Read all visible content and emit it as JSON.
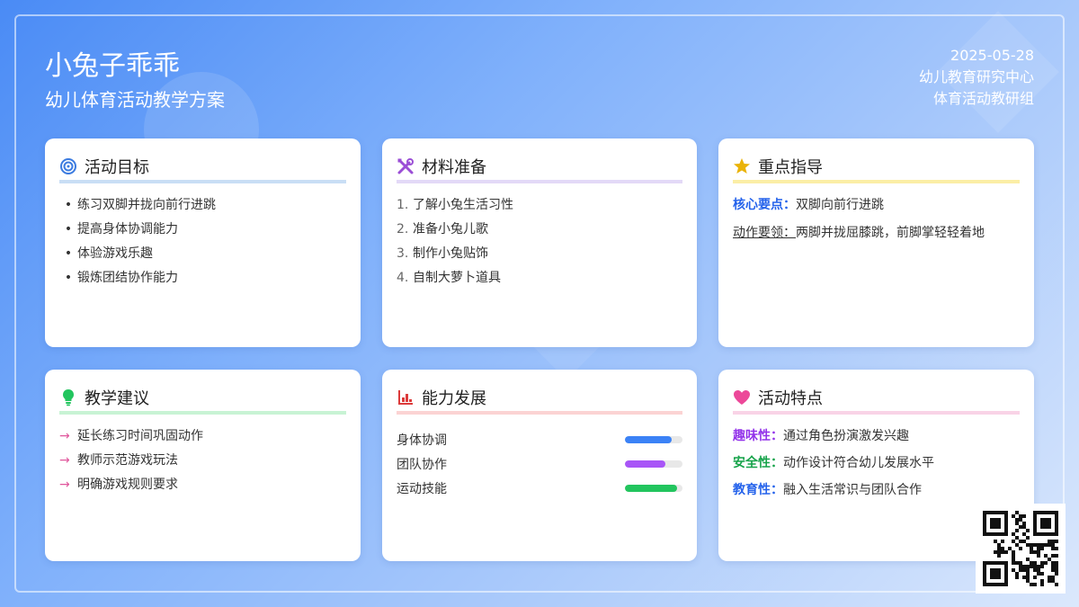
{
  "header": {
    "title": "小兔子乖乖",
    "subtitle": "幼儿体育活动教学方案",
    "date": "2025-05-28",
    "org": "幼儿教育研究中心",
    "group": "体育活动教研组"
  },
  "cards": {
    "goals": {
      "title": "活动目标",
      "icon": "target-icon",
      "color": "#c9def5",
      "items": [
        "练习双脚并拢向前行进跳",
        "提高身体协调能力",
        "体验游戏乐趣",
        "锻炼团结协作能力"
      ]
    },
    "materials": {
      "title": "材料准备",
      "icon": "tools-icon",
      "color": "#e3d9f7",
      "items": [
        "了解小兔生活习性",
        "准备小兔儿歌",
        "制作小兔贴饰",
        "自制大萝卜道具"
      ],
      "numbers": [
        "1.",
        "2.",
        "3.",
        "4."
      ]
    },
    "guidance": {
      "title": "重点指导",
      "icon": "star-icon",
      "color": "#fbeea6",
      "core_label": "核心要点：",
      "core_value": "双脚向前行进跳",
      "action_label": "动作要领：",
      "action_value": "两脚并拢屈膝跳，前脚掌轻轻着地"
    },
    "suggestions": {
      "title": "教学建议",
      "icon": "lightbulb-icon",
      "color": "#c8f3d4",
      "items": [
        "延长练习时间巩固动作",
        "教师示范游戏玩法",
        "明确游戏规则要求"
      ]
    },
    "abilities": {
      "title": "能力发展",
      "icon": "bar-chart-icon",
      "color": "#fbd3d3",
      "skills": [
        {
          "label": "身体协调",
          "level": 0.82,
          "color": "#3b82f6"
        },
        {
          "label": "团队协作",
          "level": 0.7,
          "color": "#a855f7"
        },
        {
          "label": "运动技能",
          "level": 0.9,
          "color": "#22c55e"
        }
      ]
    },
    "features": {
      "title": "活动特点",
      "icon": "heart-icon",
      "color": "#f9d3e6",
      "items": [
        {
          "label": "趣味性：",
          "value": "通过角色扮演激发兴趣",
          "color": "#9333ea"
        },
        {
          "label": "安全性：",
          "value": "动作设计符合幼儿发展水平",
          "color": "#16a34a"
        },
        {
          "label": "教育性：",
          "value": "融入生活常识与团队合作",
          "color": "#2563eb"
        }
      ]
    }
  }
}
